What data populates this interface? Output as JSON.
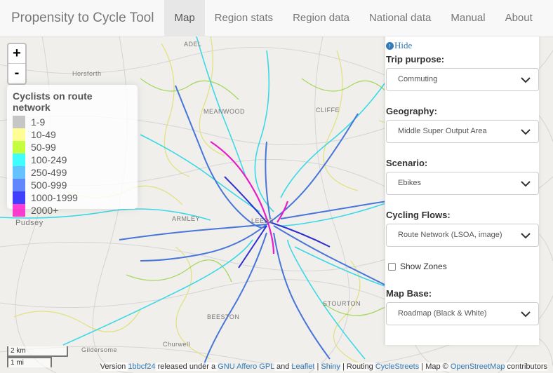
{
  "navbar": {
    "brand": "Propensity to Cycle Tool",
    "items": [
      {
        "label": "Map",
        "active": true
      },
      {
        "label": "Region stats",
        "active": false
      },
      {
        "label": "Region data",
        "active": false
      },
      {
        "label": "National data",
        "active": false
      },
      {
        "label": "Manual",
        "active": false
      },
      {
        "label": "About",
        "active": false
      }
    ]
  },
  "zoom": {
    "in": "+",
    "out": "-"
  },
  "legend": {
    "title": "Cyclists on route network",
    "entries": [
      {
        "label": "1-9",
        "color": "#b4b4b4"
      },
      {
        "label": "10-49",
        "color": "#ffff73"
      },
      {
        "label": "50-99",
        "color": "#afff00"
      },
      {
        "label": "100-249",
        "color": "#00ffff"
      },
      {
        "label": "250-499",
        "color": "#30b0ff"
      },
      {
        "label": "500-999",
        "color": "#2e5fff"
      },
      {
        "label": "1000-1999",
        "color": "#0000ff"
      },
      {
        "label": "2000+",
        "color": "#ff00c5"
      }
    ]
  },
  "panel": {
    "hide_label": "Hide",
    "trip_purpose": {
      "label": "Trip purpose:",
      "value": "Commuting"
    },
    "geography": {
      "label": "Geography:",
      "value": "Middle Super Output Area"
    },
    "scenario": {
      "label": "Scenario:",
      "value": "Ebikes"
    },
    "cycling_flows": {
      "label": "Cycling Flows:",
      "value": "Route Network (LSOA, image)"
    },
    "show_zones": {
      "label": "Show Zones",
      "checked": false
    },
    "map_base": {
      "label": "Map Base:",
      "value": "Roadmap (Black & White)"
    }
  },
  "scale": {
    "km": "2 km",
    "mi": "1 mi"
  },
  "places": [
    "Horsforth",
    "MEANWOOD",
    "Pudsey",
    "ARMLEY",
    "BEESTON",
    "Churwell",
    "Gildersome",
    "STOURTON",
    "LEEDS",
    "ADEL",
    "CLIFFE"
  ],
  "footer": {
    "version_prefix": "Version ",
    "version_link": "1bbcf24",
    "released": " released under a ",
    "license_link": "GNU Affero GPL",
    "and": " and ",
    "leaflet_link": "Leaflet",
    "sep1": " | ",
    "shiny_link": "Shiny",
    "routing": " | Routing ",
    "cyclestreets_link": "CycleStreets",
    "map_prefix": " | Map © ",
    "osm_link": "OpenStreetMap",
    "contributors": " contributors"
  }
}
